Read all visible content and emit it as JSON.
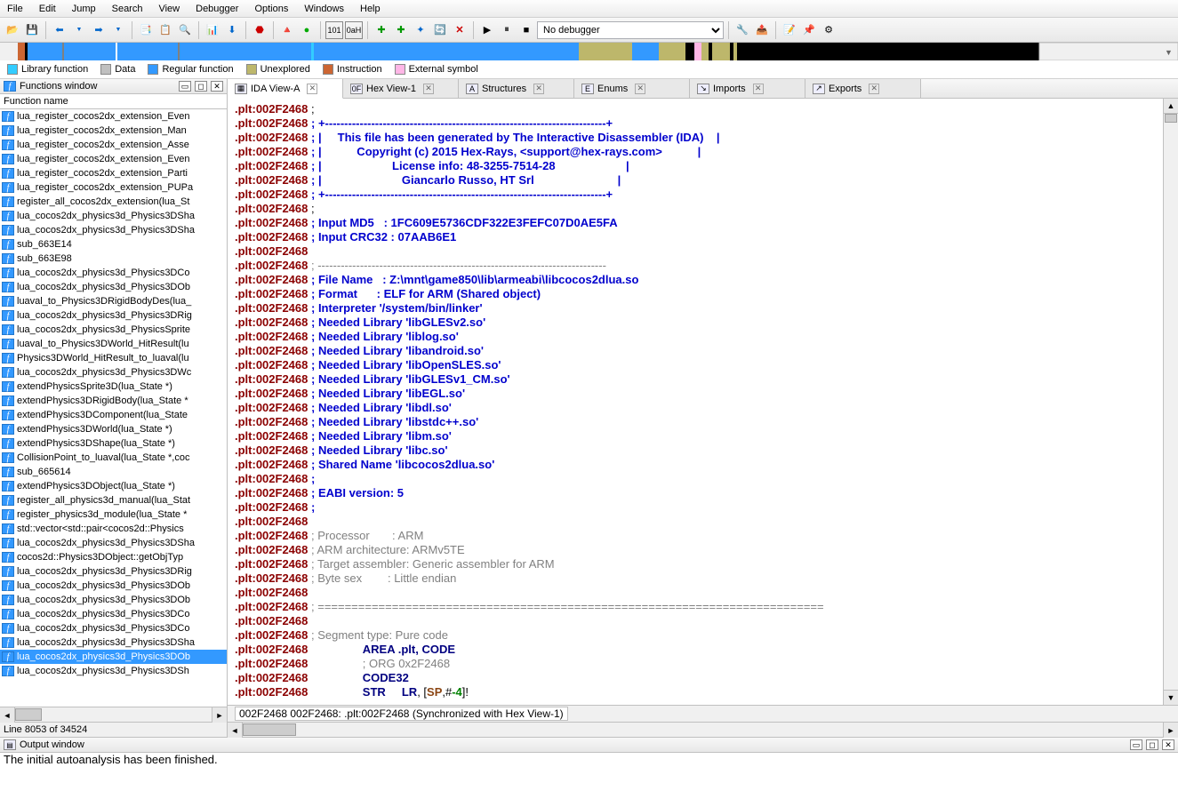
{
  "menu": [
    "File",
    "Edit",
    "Jump",
    "Search",
    "View",
    "Debugger",
    "Options",
    "Windows",
    "Help"
  ],
  "debugger_combo": "No debugger",
  "legend": [
    {
      "color": "#33ccff",
      "label": "Library function"
    },
    {
      "color": "#c0c0c0",
      "label": "Data"
    },
    {
      "color": "#3399ff",
      "label": "Regular function"
    },
    {
      "color": "#bdb76b",
      "label": "Unexplored"
    },
    {
      "color": "#cc6633",
      "label": "Instruction"
    },
    {
      "color": "#ffb6e6",
      "label": "External symbol"
    }
  ],
  "functions_window": {
    "title": "Functions window",
    "header": "Function name",
    "items": [
      "lua_register_cocos2dx_extension_Even",
      "lua_register_cocos2dx_extension_Man",
      "lua_register_cocos2dx_extension_Asse",
      "lua_register_cocos2dx_extension_Even",
      "lua_register_cocos2dx_extension_Parti",
      "lua_register_cocos2dx_extension_PUPa",
      "register_all_cocos2dx_extension(lua_St",
      "lua_cocos2dx_physics3d_Physics3DSha",
      "lua_cocos2dx_physics3d_Physics3DSha",
      "sub_663E14",
      "sub_663E98",
      "lua_cocos2dx_physics3d_Physics3DCo",
      "lua_cocos2dx_physics3d_Physics3DOb",
      "luaval_to_Physics3DRigidBodyDes(lua_",
      "lua_cocos2dx_physics3d_Physics3DRig",
      "lua_cocos2dx_physics3d_PhysicsSprite",
      "luaval_to_Physics3DWorld_HitResult(lu",
      "Physics3DWorld_HitResult_to_luaval(lu",
      "lua_cocos2dx_physics3d_Physics3DWc",
      "extendPhysicsSprite3D(lua_State *)",
      "extendPhysics3DRigidBody(lua_State *",
      "extendPhysics3DComponent(lua_State",
      "extendPhysics3DWorld(lua_State *)",
      "extendPhysics3DShape(lua_State *)",
      "CollisionPoint_to_luaval(lua_State *,coc",
      "sub_665614",
      "extendPhysics3DObject(lua_State *)",
      "register_all_physics3d_manual(lua_Stat",
      "register_physics3d_module(lua_State *",
      "std::vector<std::pair<cocos2d::Physics",
      "lua_cocos2dx_physics3d_Physics3DSha",
      "cocos2d::Physics3DObject::getObjTyp",
      "lua_cocos2dx_physics3d_Physics3DRig",
      "lua_cocos2dx_physics3d_Physics3DOb",
      "lua_cocos2dx_physics3d_Physics3DOb",
      "lua_cocos2dx_physics3d_Physics3DCo",
      "lua_cocos2dx_physics3d_Physics3DCo",
      "lua_cocos2dx_physics3d_Physics3DSha",
      "lua_cocos2dx_physics3d_Physics3DOb",
      "lua_cocos2dx_physics3d_Physics3DSh"
    ],
    "selected_index": 38,
    "status": "Line 8053 of 34524"
  },
  "tabs": [
    {
      "label": "IDA View-A",
      "active": true
    },
    {
      "label": "Hex View-1",
      "active": false
    },
    {
      "label": "Structures",
      "active": false
    },
    {
      "label": "Enums",
      "active": false
    },
    {
      "label": "Imports",
      "active": false
    },
    {
      "label": "Exports",
      "active": false
    }
  ],
  "disasm": {
    "addr": ".plt:002F2468",
    "lines": [
      {
        "t": ";"
      },
      {
        "t": "; +-------------------------------------------------------------------------+",
        "c": "blue"
      },
      {
        "t": "; |     This file has been generated by The Interactive Disassembler (IDA)    |",
        "c": "blue"
      },
      {
        "t": "; |           Copyright (c) 2015 Hex-Rays, <support@hex-rays.com>           |",
        "c": "blue"
      },
      {
        "t": "; |                      License info: 48-3255-7514-28                      |",
        "c": "blue"
      },
      {
        "t": "; |                         Giancarlo Russo, HT Srl                          |",
        "c": "blue"
      },
      {
        "t": "; +-------------------------------------------------------------------------+",
        "c": "blue"
      },
      {
        "t": ";"
      },
      {
        "t": "; Input MD5   : 1FC609E5736CDF322E3FEFC07D0AE5FA",
        "c": "blue"
      },
      {
        "t": "; Input CRC32 : 07AAB6E1",
        "c": "blue"
      },
      {
        "t": ""
      },
      {
        "t": "; ---------------------------------------------------------------------------",
        "c": "cmt"
      },
      {
        "t": "; File Name   : Z:\\mnt\\game850\\lib\\armeabi\\libcocos2dlua.so",
        "c": "blue"
      },
      {
        "t": "; Format      : ELF for ARM (Shared object)",
        "c": "blue"
      },
      {
        "t": "; Interpreter '/system/bin/linker'",
        "c": "blue"
      },
      {
        "t": "; Needed Library 'libGLESv2.so'",
        "c": "blue"
      },
      {
        "t": "; Needed Library 'liblog.so'",
        "c": "blue"
      },
      {
        "t": "; Needed Library 'libandroid.so'",
        "c": "blue"
      },
      {
        "t": "; Needed Library 'libOpenSLES.so'",
        "c": "blue"
      },
      {
        "t": "; Needed Library 'libGLESv1_CM.so'",
        "c": "blue"
      },
      {
        "t": "; Needed Library 'libEGL.so'",
        "c": "blue"
      },
      {
        "t": "; Needed Library 'libdl.so'",
        "c": "blue"
      },
      {
        "t": "; Needed Library 'libstdc++.so'",
        "c": "blue"
      },
      {
        "t": "; Needed Library 'libm.so'",
        "c": "blue"
      },
      {
        "t": "; Needed Library 'libc.so'",
        "c": "blue"
      },
      {
        "t": "; Shared Name 'libcocos2dlua.so'",
        "c": "blue"
      },
      {
        "t": ";",
        "c": "blue"
      },
      {
        "t": "; EABI version: 5",
        "c": "blue"
      },
      {
        "t": ";",
        "c": "blue"
      },
      {
        "t": ""
      },
      {
        "t": "; Processor       : ARM",
        "c": "cmt"
      },
      {
        "t": "; ARM architecture: ARMv5TE",
        "c": "cmt"
      },
      {
        "t": "; Target assembler: Generic assembler for ARM",
        "c": "cmt"
      },
      {
        "t": "; Byte sex        : Little endian",
        "c": "cmt"
      },
      {
        "t": ""
      },
      {
        "t": "; ===========================================================================",
        "c": "cmt"
      },
      {
        "t": ""
      },
      {
        "t": "; Segment type: Pure code",
        "c": "cmt"
      },
      {
        "raw": "                <span class='navy'>AREA .plt, CODE</span>"
      },
      {
        "raw": "                <span class='cmt'>; ORG 0x2F2468</span>"
      },
      {
        "raw": "                <span class='navy'>CODE32</span>"
      },
      {
        "raw": "                <span class='navy'>STR</span>     <span class='navy'>LR</span>, [<span class='brown'>SP</span>,#<span class='green'>-4</span>]!"
      }
    ]
  },
  "sync_bar": "002F2468 002F2468: .plt:002F2468 (Synchronized with Hex View-1)",
  "output_window": {
    "title": "Output window",
    "lines": [
      "The initial autoanalysis has been finished."
    ]
  }
}
